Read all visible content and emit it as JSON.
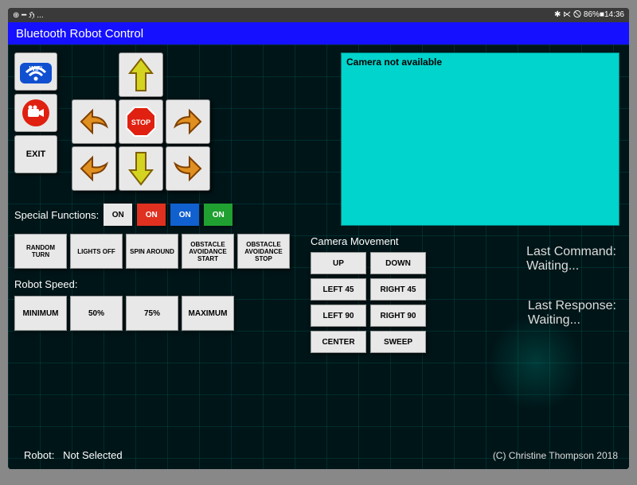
{
  "statusbar": {
    "left": "⊕ ━ ℌ ...",
    "right": "✱ ⋉ 🛇 86%■14:36"
  },
  "title": "Bluetooth Robot Control",
  "sideButtons": {
    "wifi": "WiFi",
    "record": "●",
    "exit": "EXIT"
  },
  "dpad": {
    "stop": "STOP"
  },
  "camera": {
    "message": "Camera not available"
  },
  "special": {
    "label": "Special Functions:",
    "toggles": [
      {
        "label": "ON",
        "color": "#e8e8e8",
        "text": "#000"
      },
      {
        "label": "ON",
        "color": "#e03020",
        "text": "#fff"
      },
      {
        "label": "ON",
        "color": "#1060d0",
        "text": "#fff"
      },
      {
        "label": "ON",
        "color": "#20a030",
        "text": "#fff"
      }
    ]
  },
  "functions": [
    "RANDOM TURN",
    "LIGHTS OFF",
    "SPIN AROUND",
    "OBSTACLE AVOIDANCE START",
    "OBSTACLE AVOIDANCE STOP"
  ],
  "speed": {
    "label": "Robot Speed:",
    "options": [
      "MINIMUM",
      "50%",
      "75%",
      "MAXIMUM"
    ]
  },
  "cameraMovement": {
    "label": "Camera Movement",
    "buttons": [
      "UP",
      "DOWN",
      "LEFT 45",
      "RIGHT 45",
      "LEFT 90",
      "RIGHT 90",
      "CENTER",
      "SWEEP"
    ]
  },
  "lastCommand": {
    "label": "Last Command:",
    "value": "Waiting..."
  },
  "lastResponse": {
    "label": "Last Response:",
    "value": "Waiting..."
  },
  "robot": {
    "label": "Robot:",
    "value": "Not Selected"
  },
  "copyright": "(C) Christine Thompson 2018"
}
